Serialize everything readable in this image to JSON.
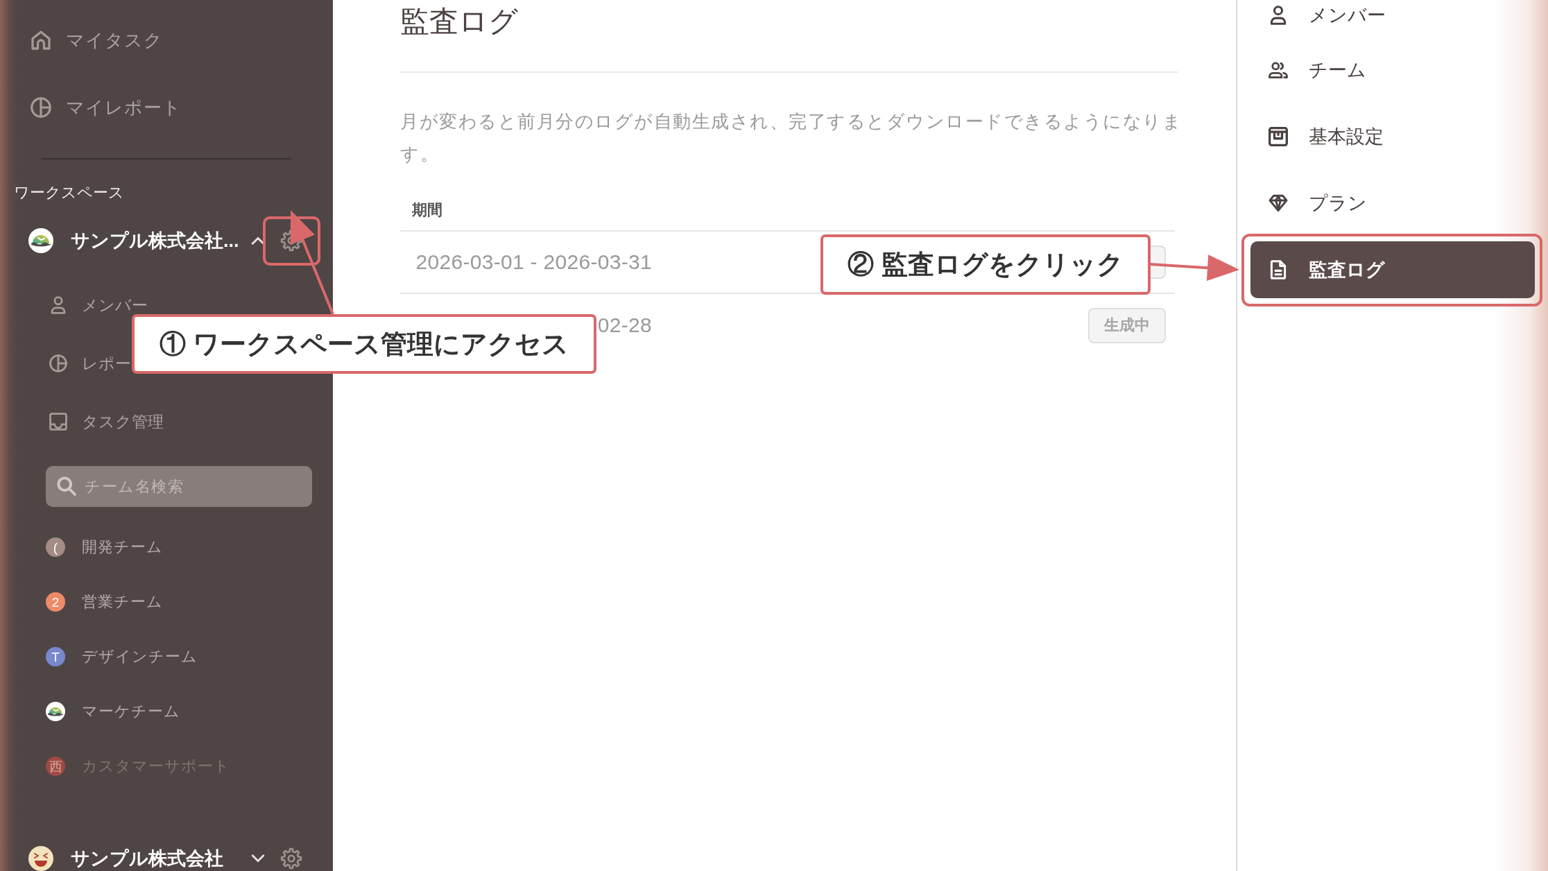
{
  "sidebar": {
    "nav_items": [
      {
        "label": "マイタスク"
      },
      {
        "label": "マイレポート"
      }
    ],
    "section_label": "ワークスペース",
    "workspace": {
      "name": "サンプル株式会社...",
      "expanded": true,
      "sub_items": [
        {
          "label": "メンバー"
        },
        {
          "label": "レポー"
        },
        {
          "label": "タスク管理"
        }
      ],
      "team_search": {
        "placeholder": "チーム名検索"
      },
      "teams": [
        {
          "name": "開発チーム",
          "kind": "letter",
          "avatar_text": "(",
          "color": "#a38d84",
          "disabled": false
        },
        {
          "name": "営業チーム",
          "kind": "letter",
          "avatar_text": "2",
          "color": "#ee8a68",
          "disabled": false
        },
        {
          "name": "デザインチーム",
          "kind": "letter",
          "avatar_text": "T",
          "color": "#7888cc",
          "disabled": false
        },
        {
          "name": "マーケチーム",
          "kind": "logo",
          "disabled": false
        },
        {
          "name": "カスタマーサポート",
          "kind": "letter",
          "avatar_text": "西",
          "color": "#9e4a42",
          "disabled": true
        }
      ]
    },
    "other_workspace": {
      "name": "サンプル株式会社",
      "expanded": false
    }
  },
  "main": {
    "title": "監査ログ",
    "description": "月が変わると前月分のログが自動生成され、完了するとダウンロードできるようになります。",
    "table": {
      "columns": [
        "期間"
      ],
      "rows": [
        {
          "period": "2026-03-01 - 2026-03-31"
        },
        {
          "period": "02-28",
          "button": {
            "label": "生成中",
            "disabled": true
          }
        }
      ]
    }
  },
  "settings_menu": {
    "items": [
      {
        "label": "メンバー",
        "selected": false
      },
      {
        "label": "チーム",
        "selected": false
      },
      {
        "label": "基本設定",
        "selected": false
      },
      {
        "label": "プラン",
        "selected": false
      },
      {
        "label": "監査ログ",
        "selected": true
      }
    ]
  },
  "annotations": [
    {
      "text": "① ワークスペース管理にアクセス"
    },
    {
      "text": "② 監査ログをクリック"
    }
  ]
}
